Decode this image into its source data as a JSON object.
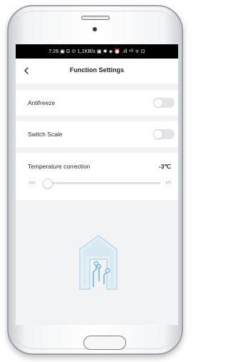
{
  "status_bar": {
    "text": "7:26 ▣ G ⊙    1,1KB/s ▣ ✱ ◈ ⏰ .ıll ⁴ᴳ ᯤ ⊡"
  },
  "header": {
    "back_icon": "chevron-left-icon",
    "title": "Function Settings"
  },
  "settings": {
    "antifreeze": {
      "label": "Antifreeze",
      "enabled": false
    },
    "switch_scale": {
      "label": "Switch Scale",
      "enabled": false
    },
    "temperature_correction": {
      "label": "Temperature correction",
      "value": "-3℃",
      "slider_min": "-3℃",
      "slider_max": "3℃",
      "slider_position": 0.0
    }
  },
  "logo_icon": "house-circuit-logo",
  "colors": {
    "screen_background": "#f2f3f5",
    "card_background": "#ffffff",
    "toggle_off": "#e3e4e7",
    "logo_accent": "#6fb3d9"
  }
}
